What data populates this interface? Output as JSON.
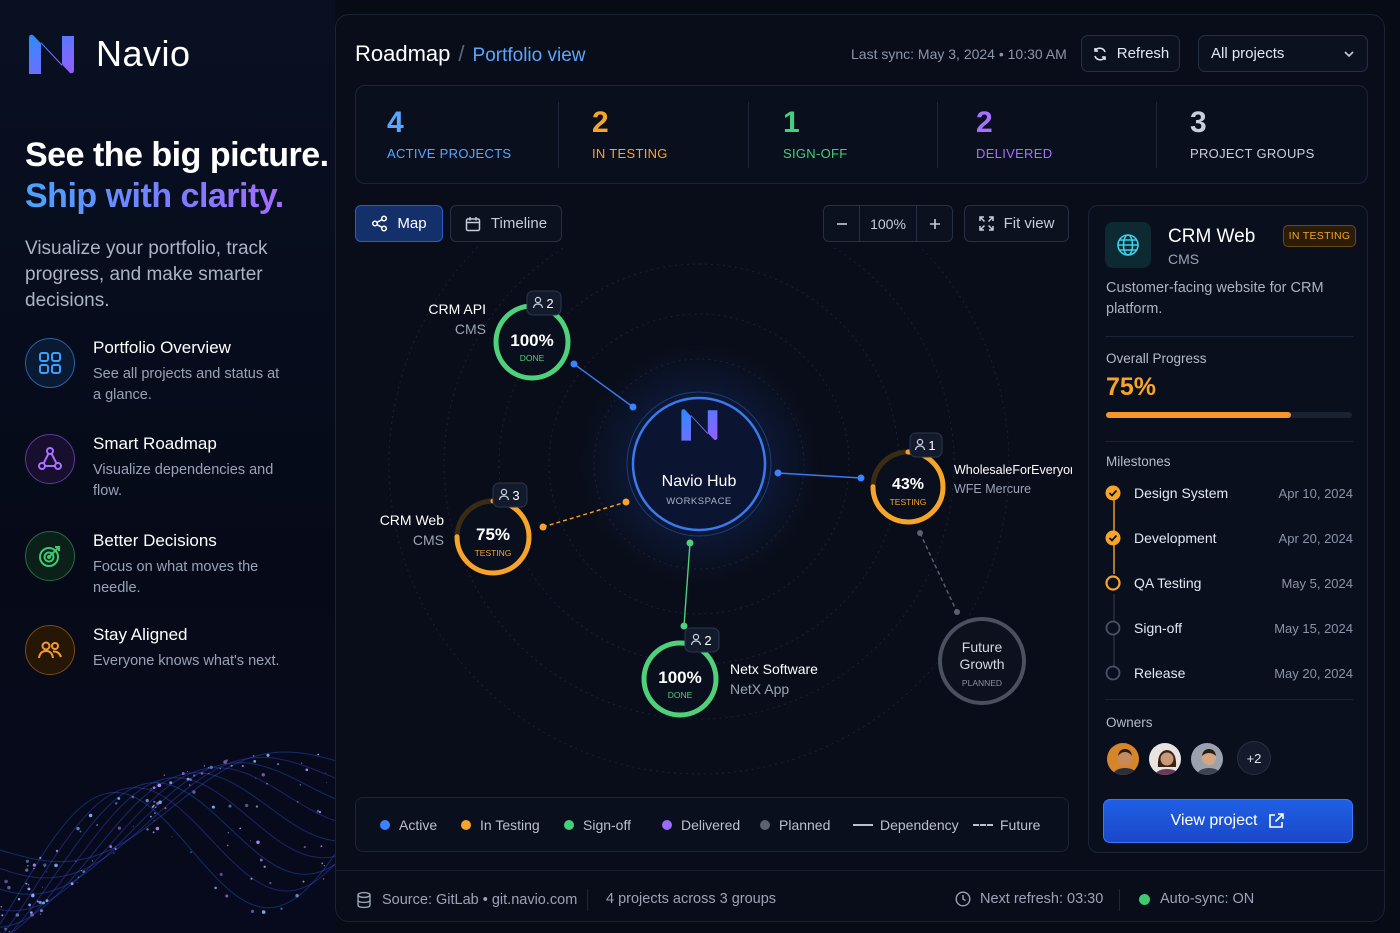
{
  "brand": {
    "name": "Navio"
  },
  "hero": {
    "line1": "See the big picture.",
    "line2": "Ship with clarity.",
    "subtitle": "Visualize your portfolio, track progress, and make smarter decisions."
  },
  "features": [
    {
      "icon": "grid-icon",
      "title": "Portfolio Overview",
      "desc": "See all projects and status at a glance.",
      "color": "#3aa0ff"
    },
    {
      "icon": "network-icon",
      "title": "Smart Roadmap",
      "desc": "Visualize dependencies and flow.",
      "color": "#a970ff"
    },
    {
      "icon": "target-icon",
      "title": "Better Decisions",
      "desc": "Focus on what moves the needle.",
      "color": "#3ec872"
    },
    {
      "icon": "users-icon",
      "title": "Stay Aligned",
      "desc": "Everyone knows what's next.",
      "color": "#f59a2a"
    }
  ],
  "header": {
    "title": "Roadmap",
    "separator": "/",
    "view": "Portfolio view",
    "last_sync": "Last sync: May 3, 2024 • 10:30 AM",
    "refresh_label": "Refresh",
    "project_filter": "All projects"
  },
  "stats": [
    {
      "value": "4",
      "label": "ACTIVE PROJECTS",
      "color": "#5aa6ff"
    },
    {
      "value": "2",
      "label": "IN TESTING",
      "color": "#f7a52a"
    },
    {
      "value": "1",
      "label": "SIGN-OFF",
      "color": "#44d07a"
    },
    {
      "value": "2",
      "label": "DELIVERED",
      "color": "#a870ff"
    },
    {
      "value": "3",
      "label": "PROJECT GROUPS",
      "color": "#c8cfdb"
    }
  ],
  "toolbar": {
    "map_label": "Map",
    "timeline_label": "Timeline",
    "zoom_level": "100%",
    "fit_label": "Fit view"
  },
  "graph": {
    "hub": {
      "name": "Navio Hub",
      "sub": "WORKSPACE"
    },
    "nodes": [
      {
        "id": "crm-api",
        "name": "CRM API",
        "group": "CMS",
        "percent": "100%",
        "status": "DONE",
        "progress": 1.0,
        "color": "#4fd07a",
        "members": "2"
      },
      {
        "id": "crm-web",
        "name": "CRM Web",
        "group": "CMS",
        "percent": "75%",
        "status": "TESTING",
        "progress": 0.75,
        "color": "#f7a52a",
        "members": "3"
      },
      {
        "id": "netx",
        "name": "Netx Software",
        "group": "NetX App",
        "percent": "100%",
        "status": "DONE",
        "progress": 1.0,
        "color": "#4fd07a",
        "members": "2"
      },
      {
        "id": "wfe",
        "name": "WholesaleForEveryone",
        "group": "WFE Mercure",
        "percent": "43%",
        "status": "TESTING",
        "progress": 0.75,
        "color": "#f7a52a",
        "members": "1"
      },
      {
        "id": "future",
        "name1": "Future",
        "name2": "Growth",
        "status": "PLANNED",
        "color": "#666d7c"
      }
    ]
  },
  "legend": [
    {
      "label": "Active",
      "color": "#3a82ff",
      "kind": "dot"
    },
    {
      "label": "In Testing",
      "color": "#f7a52a",
      "kind": "dot"
    },
    {
      "label": "Sign-off",
      "color": "#44d07a",
      "kind": "dot"
    },
    {
      "label": "Delivered",
      "color": "#9b6bff",
      "kind": "dot"
    },
    {
      "label": "Planned",
      "color": "#5b6272",
      "kind": "dot"
    },
    {
      "label": "Dependency",
      "kind": "line"
    },
    {
      "label": "Future",
      "kind": "dash"
    }
  ],
  "panel": {
    "title": "CRM Web",
    "subtitle": "CMS",
    "badge": "IN TESTING",
    "description": "Customer-facing website for CRM platform.",
    "progress_label": "Overall Progress",
    "progress_value": "75%",
    "progress": 0.75,
    "milestones_label": "Milestones",
    "milestones": [
      {
        "name": "Design System",
        "date": "Apr 10, 2024",
        "state": "done"
      },
      {
        "name": "Development",
        "date": "Apr 20, 2024",
        "state": "done"
      },
      {
        "name": "QA Testing",
        "date": "May 5, 2024",
        "state": "current"
      },
      {
        "name": "Sign-off",
        "date": "May 15, 2024",
        "state": "todo"
      },
      {
        "name": "Release",
        "date": "May 20, 2024",
        "state": "todo"
      }
    ],
    "owners_label": "Owners",
    "owners_more": "+2",
    "view_button": "View project"
  },
  "footer": {
    "source": "Source: GitLab • git.navio.com",
    "summary": "4 projects across 3 groups",
    "next_refresh": "Next refresh: 03:30",
    "autosync": "Auto-sync: ON"
  }
}
